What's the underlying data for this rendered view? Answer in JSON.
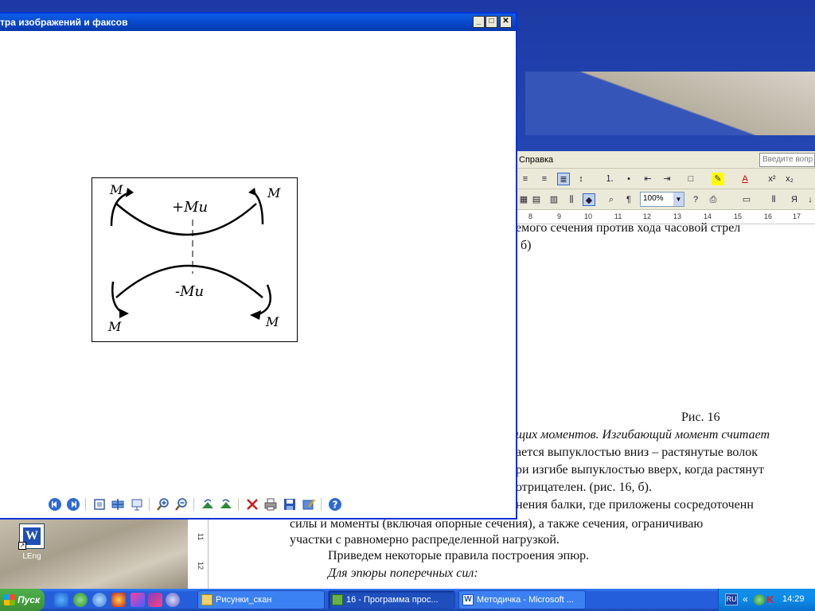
{
  "viewer": {
    "title": "тра изображений и факсов",
    "figure": {
      "top_left_label": "M",
      "top_right_label": "M",
      "top_center_label": "+Mu",
      "bottom_center_label": "-Mu",
      "bottom_left_label": "M",
      "bottom_right_label": "M"
    },
    "toolbar_icons": [
      "prev-image-icon",
      "next-image-icon",
      "best-fit-icon",
      "actual-size-icon",
      "slideshow-icon",
      "zoom-in-icon",
      "zoom-out-icon",
      "rotate-clockwise-icon",
      "rotate-counterclockwise-icon",
      "delete-icon",
      "print-icon",
      "save-icon",
      "open-editor-icon",
      "help-icon"
    ]
  },
  "word": {
    "menu_help": "Справка",
    "help_placeholder": "Введите вопр",
    "zoom": "100%",
    "ruler": [
      "8",
      "9",
      "10",
      "11",
      "12",
      "13",
      "14",
      "15",
      "16",
      "17"
    ],
    "doc_lines": [
      "емого  сечения  против  хода  часовой  стрел",
      "б)",
      "Рис. 16",
      "щих моментов. Изгибающий момент считает",
      "ается выпуклостью вниз – растянутые волок",
      "ри изгибе выпуклостью вверх, когда растянут",
      "отрицателен. (рис. 16, б).",
      "нения балки, где приложены сосредоточенн"
    ],
    "lower_lines": [
      "силы и моменты (включая опорные сечения), а также сечения, ограничиваю",
      "участки с равномерно распределенной нагрузкой.",
      "Приведем некоторые правила построения эпюр.",
      "Для эпюры поперечных сил:"
    ],
    "vruler": [
      "11",
      "12"
    ]
  },
  "desktop": {
    "icon_label": "LEng"
  },
  "taskbar": {
    "start": "Пуск",
    "buttons": [
      {
        "label": "Рисунки_скан",
        "active": false
      },
      {
        "label": "16 - Программа прос...",
        "active": true
      },
      {
        "label": "Методичка - Microsoft ...",
        "active": false
      }
    ],
    "lang": "RU",
    "chevron": "«",
    "clock": "14:29"
  }
}
